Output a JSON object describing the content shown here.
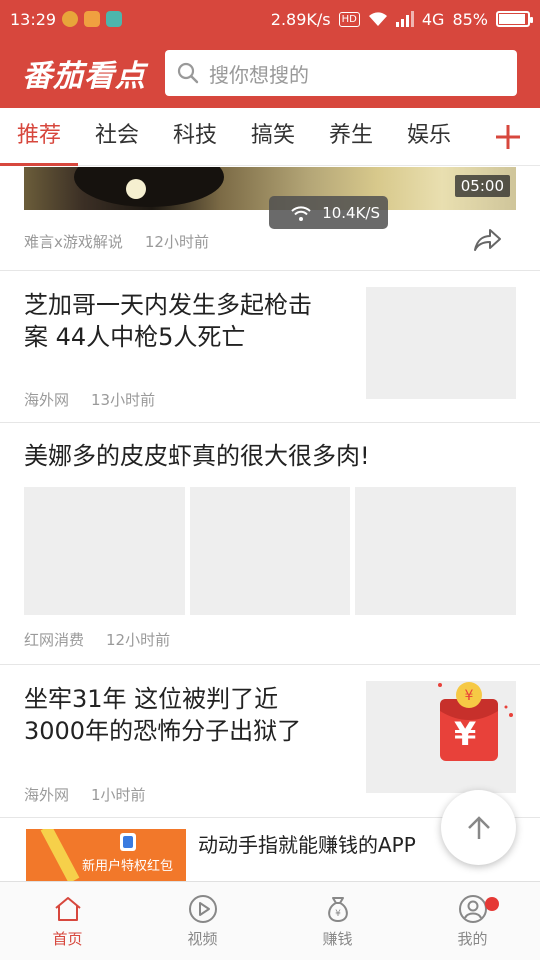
{
  "status_bar": {
    "time": "13:29",
    "network_speed": "2.89K/s",
    "hd": "HD",
    "network_type": "4G",
    "battery": "85%",
    "battery_level": 0.85
  },
  "header": {
    "logo": "番茄看点",
    "search_placeholder": "搜你想搜的"
  },
  "tabs": [
    "推荐",
    "社会",
    "科技",
    "搞笑",
    "养生",
    "娱乐"
  ],
  "active_tab": "推荐",
  "feed": {
    "video_item": {
      "duration": "05:00",
      "speed_toast": "10.4K/S",
      "source": "难言x游戏解说",
      "time": "12小时前"
    },
    "article1": {
      "title_line1": "芝加哥一天内发生多起枪击",
      "title_line2": "案 44人中枪5人死亡",
      "source": "海外网",
      "time": "13小时前"
    },
    "article2": {
      "title": "美娜多的皮皮虾真的很大很多肉!",
      "source": "红网消费",
      "time": "12小时前"
    },
    "article3": {
      "title_line1": "坐牢31年 这位被判了近",
      "title_line2": "3000年的恐怖分子出狱了",
      "source": "海外网",
      "time": "1小时前",
      "thumb_symbol": "¥"
    },
    "promo": {
      "image_text": "新用户特权红包",
      "title": "动动手指就能赚钱的APP"
    }
  },
  "bottom_nav": [
    {
      "label": "首页",
      "icon": "home-icon"
    },
    {
      "label": "视频",
      "icon": "play-icon"
    },
    {
      "label": "赚钱",
      "icon": "money-bag-icon"
    },
    {
      "label": "我的",
      "icon": "profile-icon"
    }
  ],
  "active_nav": "首页",
  "colors": {
    "brand": "#d7473d",
    "meta_text": "#9a9a9a",
    "placeholder_bg": "#eeeeee"
  }
}
